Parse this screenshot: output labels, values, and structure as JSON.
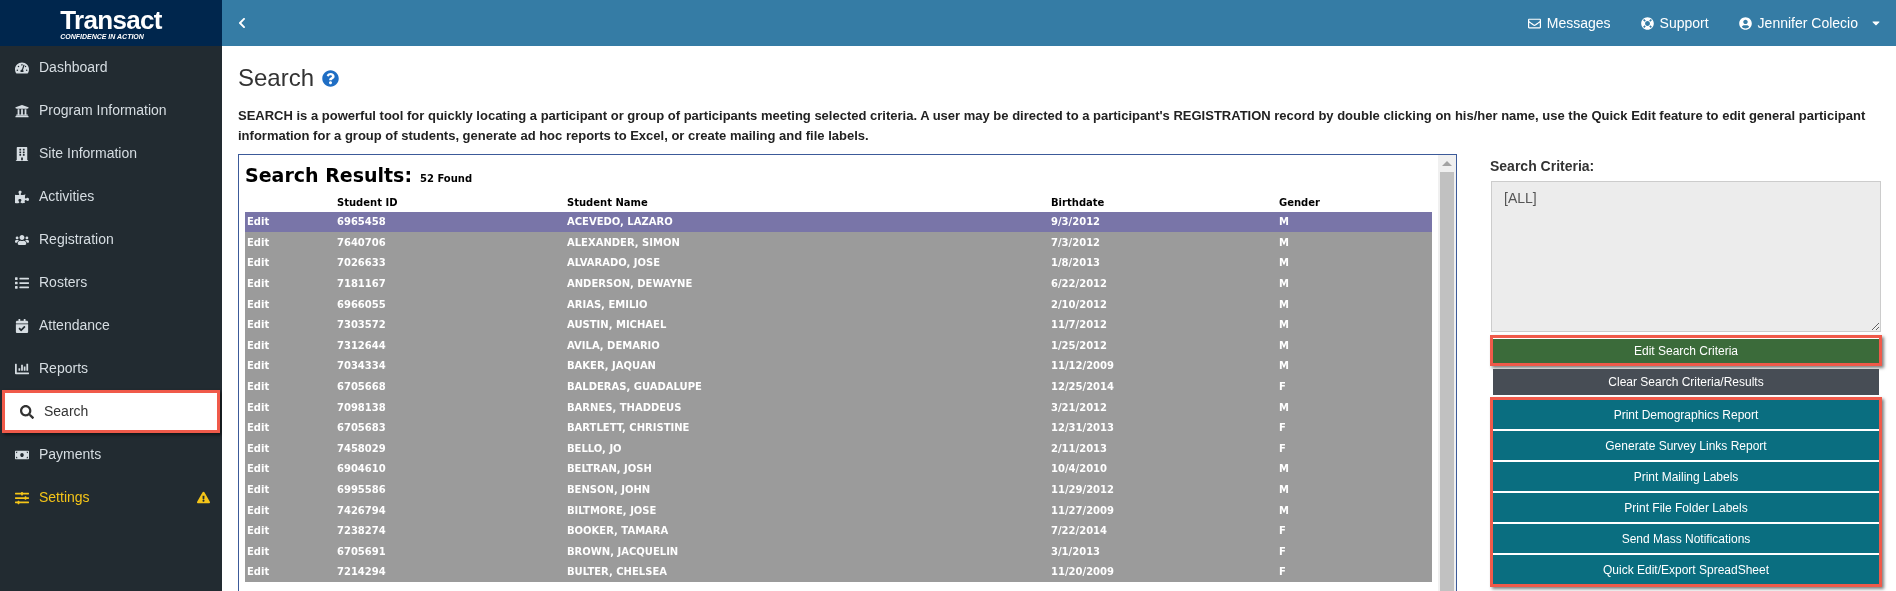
{
  "logo": {
    "text": "Transact",
    "tagline": "CONFIDENCE IN ACTION"
  },
  "sidebar": {
    "items": [
      {
        "label": "Dashboard",
        "selected": false,
        "highlighted": false,
        "warning": false,
        "kind": "normal"
      },
      {
        "label": "Program Information",
        "selected": false,
        "highlighted": false,
        "warning": false,
        "kind": "normal"
      },
      {
        "label": "Site Information",
        "selected": false,
        "highlighted": false,
        "warning": false,
        "kind": "normal"
      },
      {
        "label": "Activities",
        "selected": false,
        "highlighted": false,
        "warning": false,
        "kind": "normal"
      },
      {
        "label": "Registration",
        "selected": false,
        "highlighted": false,
        "warning": false,
        "kind": "normal"
      },
      {
        "label": "Rosters",
        "selected": false,
        "highlighted": false,
        "warning": false,
        "kind": "normal"
      },
      {
        "label": "Attendance",
        "selected": false,
        "highlighted": false,
        "warning": false,
        "kind": "normal"
      },
      {
        "label": "Reports",
        "selected": false,
        "highlighted": false,
        "warning": false,
        "kind": "normal"
      },
      {
        "label": "Search",
        "selected": true,
        "highlighted": true,
        "warning": false,
        "kind": "normal"
      },
      {
        "label": "Payments",
        "selected": false,
        "highlighted": false,
        "warning": false,
        "kind": "normal"
      },
      {
        "label": "Settings",
        "selected": false,
        "highlighted": false,
        "warning": true,
        "kind": "settings"
      }
    ]
  },
  "topbar": {
    "links": [
      {
        "label": "Messages",
        "dropdown": false
      },
      {
        "label": "Support",
        "dropdown": false
      },
      {
        "label": "Jennifer Colecio",
        "dropdown": true
      }
    ]
  },
  "page": {
    "title": "Search",
    "description": "SEARCH is a powerful tool for quickly locating a participant or group of participants meeting selected criteria. A user may be directed to a participant's REGISTRATION record by double clicking on his/her name, use the Quick Edit feature to edit general participant information for a group of students, generate ad hoc reports to Excel, or create mailing and file labels."
  },
  "results": {
    "title": "Search Results:",
    "count": "52 Found",
    "columns": [
      "Student ID",
      "Student Name",
      "Birthdate",
      "Gender"
    ],
    "rows": [
      {
        "action": "Edit",
        "id": "6965458",
        "name": "ACEVEDO, LAZARO",
        "birthdate": "9/3/2012",
        "gender": "M",
        "selected": true
      },
      {
        "action": "Edit",
        "id": "7640706",
        "name": "ALEXANDER, SIMON",
        "birthdate": "7/3/2012",
        "gender": "M",
        "selected": false
      },
      {
        "action": "Edit",
        "id": "7026633",
        "name": "ALVARADO, JOSE",
        "birthdate": "1/8/2013",
        "gender": "M",
        "selected": false
      },
      {
        "action": "Edit",
        "id": "7181167",
        "name": "ANDERSON, DEWAYNE",
        "birthdate": "6/22/2012",
        "gender": "M",
        "selected": false
      },
      {
        "action": "Edit",
        "id": "6966055",
        "name": "ARIAS, EMILIO",
        "birthdate": "2/10/2012",
        "gender": "M",
        "selected": false
      },
      {
        "action": "Edit",
        "id": "7303572",
        "name": "AUSTIN, MICHAEL",
        "birthdate": "11/7/2012",
        "gender": "M",
        "selected": false
      },
      {
        "action": "Edit",
        "id": "7312644",
        "name": "AVILA, DEMARIO",
        "birthdate": "1/25/2012",
        "gender": "M",
        "selected": false
      },
      {
        "action": "Edit",
        "id": "7034334",
        "name": "BAKER, JAQUAN",
        "birthdate": "11/12/2009",
        "gender": "M",
        "selected": false
      },
      {
        "action": "Edit",
        "id": "6705668",
        "name": "BALDERAS, GUADALUPE",
        "birthdate": "12/25/2014",
        "gender": "F",
        "selected": false
      },
      {
        "action": "Edit",
        "id": "7098138",
        "name": "BARNES, THADDEUS",
        "birthdate": "3/21/2012",
        "gender": "M",
        "selected": false
      },
      {
        "action": "Edit",
        "id": "6705683",
        "name": "BARTLETT, CHRISTINE",
        "birthdate": "12/31/2013",
        "gender": "F",
        "selected": false
      },
      {
        "action": "Edit",
        "id": "7458029",
        "name": "BELLO, JO",
        "birthdate": "2/11/2013",
        "gender": "F",
        "selected": false
      },
      {
        "action": "Edit",
        "id": "6904610",
        "name": "BELTRAN, JOSH",
        "birthdate": "10/4/2010",
        "gender": "M",
        "selected": false
      },
      {
        "action": "Edit",
        "id": "6995586",
        "name": "BENSON, JOHN",
        "birthdate": "11/29/2012",
        "gender": "M",
        "selected": false
      },
      {
        "action": "Edit",
        "id": "7426794",
        "name": "BILTMORE, JOSE",
        "birthdate": "11/27/2009",
        "gender": "M",
        "selected": false
      },
      {
        "action": "Edit",
        "id": "7238274",
        "name": "BOOKER, TAMARA",
        "birthdate": "7/22/2014",
        "gender": "F",
        "selected": false
      },
      {
        "action": "Edit",
        "id": "6705691",
        "name": "BROWN, JACQUELIN",
        "birthdate": "3/1/2013",
        "gender": "F",
        "selected": false
      },
      {
        "action": "Edit",
        "id": "7214294",
        "name": "BULTER, CHELSEA",
        "birthdate": "11/20/2009",
        "gender": "F",
        "selected": false
      }
    ]
  },
  "criteria": {
    "label": "Search Criteria:",
    "value": "[ALL]"
  },
  "actions": {
    "edit": {
      "label": "Edit Search Criteria",
      "highlighted": true
    },
    "clear": {
      "label": "Clear Search Criteria/Results"
    },
    "group_highlighted": true,
    "buttons": [
      "Print Demographics Report",
      "Generate Survey Links Report",
      "Print Mailing Labels",
      "Print File Folder Labels",
      "Send Mass Notifications",
      "Quick Edit/Export SpreadSheet"
    ]
  }
}
